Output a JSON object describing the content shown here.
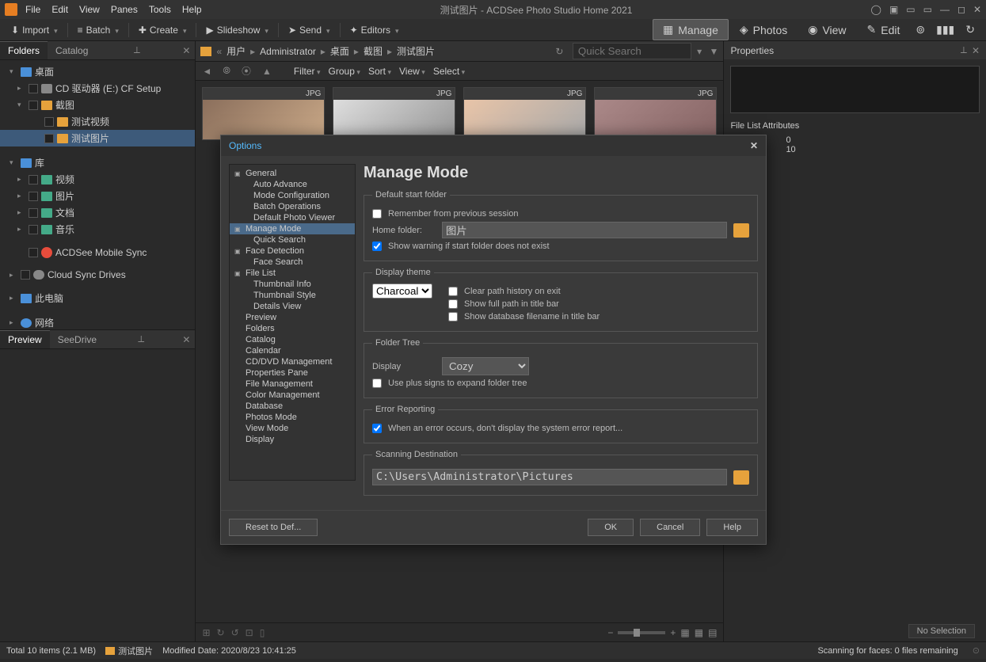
{
  "titlebar": {
    "title": "测试图片 - ACDSee Photo Studio Home 2021",
    "menus": [
      "File",
      "Edit",
      "View",
      "Panes",
      "Tools",
      "Help"
    ]
  },
  "toolbar": {
    "import": "Import",
    "batch": "Batch",
    "create": "Create",
    "slideshow": "Slideshow",
    "send": "Send",
    "editors": "Editors"
  },
  "modes": {
    "manage": "Manage",
    "photos": "Photos",
    "view": "View",
    "edit": "Edit"
  },
  "panels": {
    "folders": "Folders",
    "catalog": "Catalog",
    "preview": "Preview",
    "seedrive": "SeeDrive",
    "properties": "Properties"
  },
  "tree": {
    "desktop": "桌面",
    "cd": "CD 驱动器 (E:) CF Setup",
    "screenshot": "截图",
    "testvideo": "测试视频",
    "testimage": "测试图片",
    "library": "库",
    "video": "视频",
    "pictures": "图片",
    "documents": "文档",
    "music": "音乐",
    "mobilesync": "ACDSee Mobile Sync",
    "cloudsync": "Cloud Sync Drives",
    "thispc": "此电脑",
    "network": "网络"
  },
  "breadcrumb": {
    "user": "用户",
    "admin": "Administrator",
    "desktop": "桌面",
    "screenshot": "截图",
    "testimage": "测试图片",
    "search_placeholder": "Quick Search"
  },
  "filterbar": {
    "filter": "Filter",
    "group": "Group",
    "sort": "Sort",
    "view": "View",
    "select": "Select"
  },
  "thumbs": {
    "badge": "JPG"
  },
  "properties": {
    "file_list_attr": "File List Attributes",
    "val1": "0",
    "val2": "10"
  },
  "options": {
    "title": "Options",
    "tree": {
      "general": "General",
      "auto_advance": "Auto Advance",
      "mode_config": "Mode Configuration",
      "batch_ops": "Batch Operations",
      "default_viewer": "Default Photo Viewer",
      "manage_mode": "Manage Mode",
      "quick_search": "Quick Search",
      "face_detection": "Face Detection",
      "face_search": "Face Search",
      "file_list": "File List",
      "thumb_info": "Thumbnail Info",
      "thumb_style": "Thumbnail Style",
      "details_view": "Details View",
      "preview": "Preview",
      "folders": "Folders",
      "catalog": "Catalog",
      "calendar": "Calendar",
      "cddvd": "CD/DVD Management",
      "prop_pane": "Properties Pane",
      "file_mgmt": "File Management",
      "color_mgmt": "Color Management",
      "database": "Database",
      "photos_mode": "Photos Mode",
      "view_mode": "View Mode",
      "display": "Display"
    },
    "content": {
      "heading": "Manage Mode",
      "default_start_folder": "Default start folder",
      "remember_prev": "Remember from previous session",
      "home_folder": "Home folder:",
      "home_folder_val": "图片",
      "show_warning": "Show warning if start folder does not exist",
      "display_theme": "Display theme",
      "theme_val": "Charcoal",
      "clear_path": "Clear path history on exit",
      "show_full_path": "Show full path in title bar",
      "show_db_filename": "Show database filename in title bar",
      "folder_tree": "Folder Tree",
      "display_label": "Display",
      "display_val": "Cozy",
      "use_plus": "Use plus signs to expand folder tree",
      "error_reporting": "Error Reporting",
      "error_msg": "When an error occurs, don't display the system error report...",
      "scanning_dest": "Scanning Destination",
      "scan_path": "C:\\Users\\Administrator\\Pictures"
    },
    "buttons": {
      "reset": "Reset to Def...",
      "ok": "OK",
      "cancel": "Cancel",
      "help": "Help"
    }
  },
  "bottombar": {
    "no_selection": "No Selection"
  },
  "statusbar": {
    "total": "Total 10 items  (2.1 MB)",
    "folder": "测试图片",
    "modified": "Modified Date: 2020/8/23 10:41:25",
    "scanning": "Scanning for faces: 0 files remaining"
  }
}
